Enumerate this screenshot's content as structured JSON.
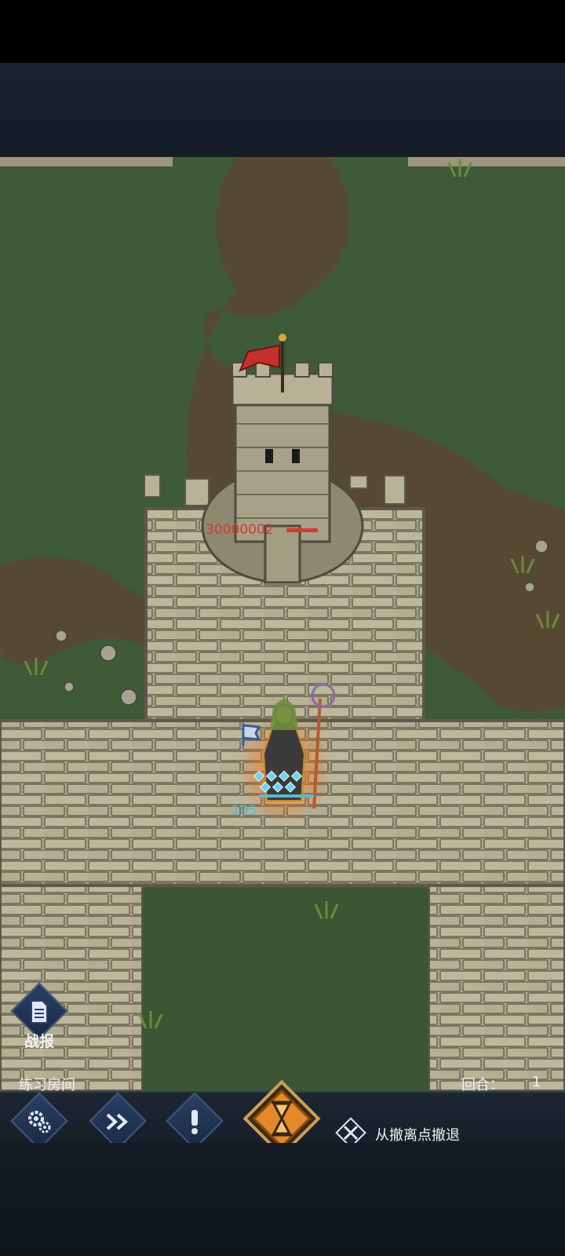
{
  "game": {
    "room_name": "练习房间",
    "round_label": "回合：",
    "round_value": "1"
  },
  "tower": {
    "hp_value": "30000002"
  },
  "hero": {
    "level_value": "195"
  },
  "report_button": {
    "label": "战报",
    "icon": "document-icon"
  },
  "toolbar": {
    "settings_label": "设置",
    "speed_label": "加速",
    "danger_label": "危险",
    "end_turn_icon": "hourglass-icon",
    "retreat_label": "从撤离点撤退"
  },
  "colors": {
    "hp_text": "#d23a3a",
    "hero_level": "#5ab7d9",
    "button_blue": "#2a3f63",
    "hourglass_gold": "#e28a2a"
  }
}
